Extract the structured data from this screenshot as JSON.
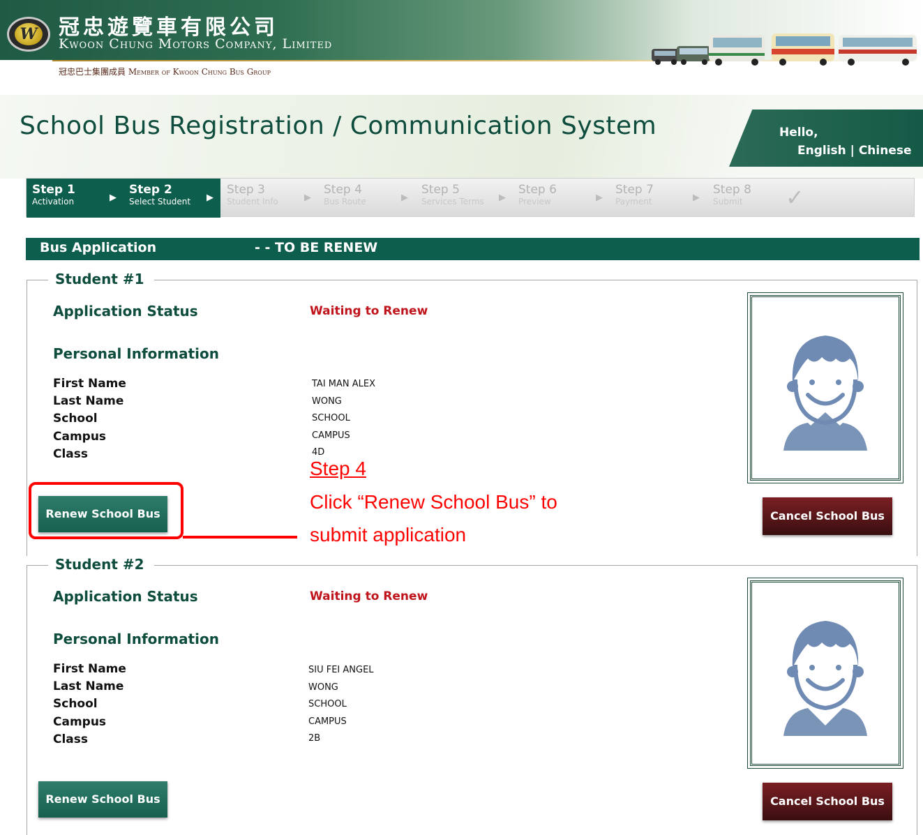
{
  "header": {
    "company_chinese": "冠忠遊覽車有限公司",
    "company_english": "Kwoon Chung Motors Company, Limited",
    "member_line": "冠忠巴士集團成員 Member of Kwoon Chung Bus Group",
    "logo_letter": "W"
  },
  "title": {
    "text": "School Bus Registration / Communication System",
    "hello": "Hello,",
    "lang_english": "English",
    "lang_separator": " | ",
    "lang_chinese": "Chinese"
  },
  "steps": [
    {
      "title": "Step 1",
      "sub": "Activation",
      "active": true
    },
    {
      "title": "Step 2",
      "sub": "Select Student",
      "active": true
    },
    {
      "title": "Step 3",
      "sub": "Student Info",
      "active": false
    },
    {
      "title": "Step 4",
      "sub": "Bus Route",
      "active": false
    },
    {
      "title": "Step 5",
      "sub": "Services Terms",
      "active": false
    },
    {
      "title": "Step 6",
      "sub": "Preview",
      "active": false
    },
    {
      "title": "Step 7",
      "sub": "Payment",
      "active": false
    },
    {
      "title": "Step 8",
      "sub": "Submit",
      "active": false
    }
  ],
  "check_icon": "checkmark-icon",
  "app_bar": {
    "title": "Bus Application",
    "subtitle": "- - TO BE RENEW"
  },
  "labels": {
    "application_status": "Application Status",
    "personal_information": "Personal Information",
    "first_name": "First Name",
    "last_name": "Last Name",
    "school": "School",
    "campus": "Campus",
    "class": "Class",
    "renew_button": "Renew School Bus",
    "cancel_button": "Cancel School Bus"
  },
  "students": [
    {
      "legend": "Student #1",
      "status": "Waiting to Renew",
      "first_name": "TAI MAN ALEX",
      "last_name": "WONG",
      "school": "SCHOOL",
      "campus": "CAMPUS",
      "class": "4D"
    },
    {
      "legend": "Student #2",
      "status": "Waiting to Renew",
      "first_name": "SIU FEI ANGEL",
      "last_name": "WONG",
      "school": "SCHOOL",
      "campus": "CAMPUS",
      "class": "2B"
    }
  ],
  "annotation": {
    "step": "Step 4",
    "line1": "Click “Renew School Bus” to",
    "line2": "submit application"
  },
  "colors": {
    "brand_green": "#0e5e4d",
    "status_red": "#c0141c",
    "annotation_red": "#ff0000",
    "cancel_maroon": "#5a1518"
  }
}
